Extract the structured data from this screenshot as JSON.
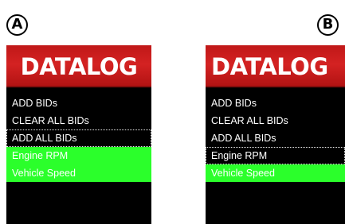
{
  "panels": {
    "a": {
      "label": "A",
      "title": "DATALOG",
      "items": [
        {
          "label": "ADD BIDs",
          "state": "normal"
        },
        {
          "label": "CLEAR ALL BIDs",
          "state": "normal"
        },
        {
          "label": "ADD ALL BIDs",
          "state": "focused"
        },
        {
          "label": "Engine RPM",
          "state": "selected"
        },
        {
          "label": "Vehicle Speed",
          "state": "selected"
        }
      ]
    },
    "b": {
      "label": "B",
      "title": "DATALOG",
      "items": [
        {
          "label": "ADD BIDs",
          "state": "normal"
        },
        {
          "label": "CLEAR ALL BIDs",
          "state": "normal"
        },
        {
          "label": "ADD ALL BIDs",
          "state": "normal"
        },
        {
          "label": "Engine RPM",
          "state": "focused"
        },
        {
          "label": "Vehicle Speed",
          "state": "selected"
        }
      ]
    }
  },
  "colors": {
    "title_bar": "#c81c1c",
    "screen_background": "#000000",
    "selected_highlight": "#2bff2b",
    "text": "#ffffff"
  }
}
